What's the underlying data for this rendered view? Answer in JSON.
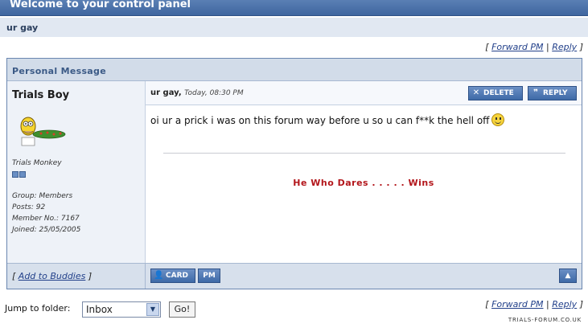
{
  "header": {
    "title": "Welcome to your control panel"
  },
  "subject_bar": {
    "text": "ur gay"
  },
  "top_links": {
    "open": "[",
    "forward": "Forward PM",
    "sep": "|",
    "reply": "Reply",
    "close": "]"
  },
  "pm_box": {
    "title": "Personal Message",
    "author": {
      "name": "Trials Boy",
      "title": "Trials Monkey",
      "pips": 2,
      "group": "Group: Members",
      "posts": "Posts: 92",
      "member_no": "Member No.: 7167",
      "joined": "Joined: 25/05/2005"
    },
    "message": {
      "subject": "ur gay",
      "date": "Today, 08:30 PM",
      "body": "oi ur a prick i was on this forum way before u so u can f**k the hell off",
      "signature": "He Who Dares . . . . . Wins"
    },
    "buttons": {
      "delete": "DELETE",
      "reply": "REPLY",
      "card": "CARD",
      "pm": "PM"
    },
    "add_buddies": {
      "open": "[",
      "label": "Add to Buddies",
      "close": "]"
    },
    "icons": {
      "delete": "x-icon",
      "reply": "quote-icon",
      "card": "user-icon",
      "top": "arrow-up-icon",
      "smiley": "smiley-icon"
    }
  },
  "bottom_links": {
    "open": "[",
    "forward": "Forward PM",
    "sep": "|",
    "reply": "Reply",
    "close": "]"
  },
  "jump": {
    "label": "Jump to folder:",
    "selected": "Inbox",
    "go": "Go!"
  },
  "footer": {
    "site": "TRIALS-FORUM.CO.UK"
  },
  "colors": {
    "header": "#3f669f",
    "accent": "#22408a",
    "signature": "#b3161b"
  }
}
